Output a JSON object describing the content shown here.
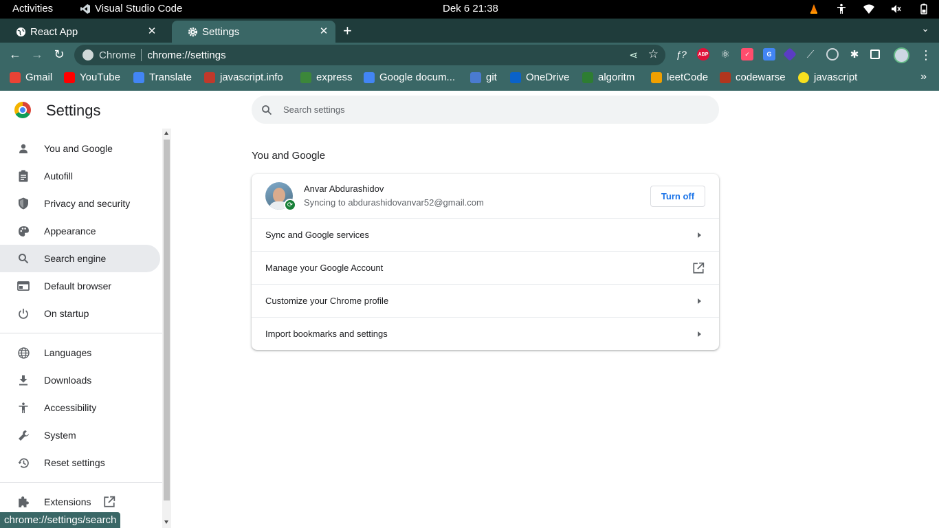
{
  "topbar": {
    "activities": "Activities",
    "app_name": "Visual Studio Code",
    "clock": "Dek 6  21:38"
  },
  "tabs": [
    {
      "title": "React App",
      "icon": "globe-icon",
      "active": false
    },
    {
      "title": "Settings",
      "icon": "gear-icon",
      "active": true
    }
  ],
  "toolbar": {
    "omnibox_host": "Chrome",
    "omnibox_url": "chrome://settings"
  },
  "bookmarks": [
    {
      "label": "Gmail",
      "color": "#ea4335"
    },
    {
      "label": "YouTube",
      "color": "#ff0000"
    },
    {
      "label": "Translate",
      "color": "#4285f4"
    },
    {
      "label": "javascript.info",
      "color": "#c0392b"
    },
    {
      "label": "express",
      "color": "#3c873a"
    },
    {
      "label": "Google docum...",
      "color": "#4285f4"
    },
    {
      "label": "git",
      "color": "#4a7bd0"
    },
    {
      "label": "OneDrive",
      "color": "#0a62c9"
    },
    {
      "label": "algoritm",
      "color": "#2e7d32"
    },
    {
      "label": "leetCode",
      "color": "#f0a000"
    },
    {
      "label": "codewarse",
      "color": "#b1361e"
    },
    {
      "label": "javascript",
      "color": "#f7df1e"
    }
  ],
  "settings": {
    "title": "Settings",
    "search_placeholder": "Search settings",
    "nav": [
      {
        "label": "You and Google",
        "icon": "person-icon"
      },
      {
        "label": "Autofill",
        "icon": "clipboard-icon"
      },
      {
        "label": "Privacy and security",
        "icon": "shield-icon"
      },
      {
        "label": "Appearance",
        "icon": "palette-icon"
      },
      {
        "label": "Search engine",
        "icon": "search-icon",
        "selected": true
      },
      {
        "label": "Default browser",
        "icon": "browser-icon"
      },
      {
        "label": "On startup",
        "icon": "power-icon"
      },
      {
        "label": "Languages",
        "icon": "globe-icon"
      },
      {
        "label": "Downloads",
        "icon": "download-icon"
      },
      {
        "label": "Accessibility",
        "icon": "accessibility-icon"
      },
      {
        "label": "System",
        "icon": "wrench-icon"
      },
      {
        "label": "Reset settings",
        "icon": "history-icon"
      }
    ],
    "extensions_label": "Extensions",
    "section_title": "You and Google",
    "account": {
      "name": "Anvar Abdurashidov",
      "email": "Syncing to abdurashidovanvar52@gmail.com",
      "turn_off": "Turn off"
    },
    "rows": [
      {
        "label": "Sync and Google services",
        "kind": "arrow"
      },
      {
        "label": "Manage your Google Account",
        "kind": "external"
      },
      {
        "label": "Customize your Chrome profile",
        "kind": "arrow"
      },
      {
        "label": "Import bookmarks and settings",
        "kind": "arrow"
      }
    ]
  },
  "status_url": "chrome://settings/search",
  "colors": {
    "frame": "#3a6766",
    "tabstrip": "#1f3c3b",
    "accent_blue": "#1a73e8"
  }
}
